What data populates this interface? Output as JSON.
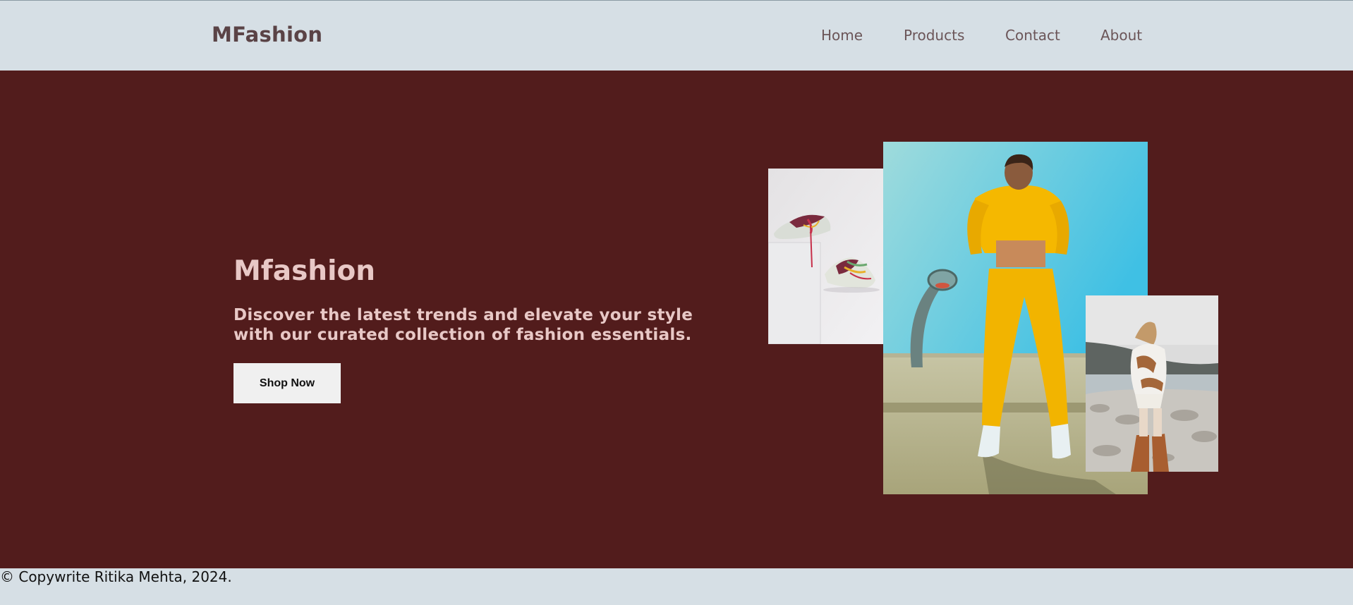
{
  "header": {
    "brand": "MFashion",
    "nav": [
      {
        "label": "Home"
      },
      {
        "label": "Products"
      },
      {
        "label": "Contact"
      },
      {
        "label": "About"
      }
    ]
  },
  "hero": {
    "title": "Mfashion",
    "subtitle": "Discover the latest trends and elevate your style with our curated collection of fashion essentials.",
    "cta_label": "Shop Now",
    "images": [
      {
        "subject": "sneakers on white pedestal"
      },
      {
        "subject": "model in yellow tracksuit at basketball court"
      },
      {
        "subject": "woman in brown boots on rocky shore"
      }
    ]
  },
  "footer": {
    "copyright": "© Copywrite Ritika Mehta, 2024."
  },
  "colors": {
    "header_bg": "#d6dfe5",
    "hero_bg": "#521c1c",
    "hero_text": "#e8c8c6",
    "brand_text": "#5a4346",
    "button_bg": "#f0f0f0"
  }
}
